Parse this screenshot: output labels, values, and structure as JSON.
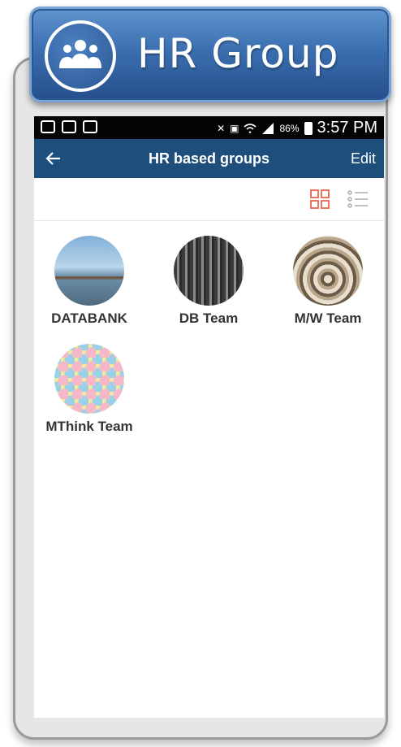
{
  "banner": {
    "title": "HR Group",
    "icon": "people-group-icon"
  },
  "status_bar": {
    "battery": "86%",
    "time": "3:57 PM"
  },
  "appbar": {
    "title": "HR based groups",
    "edit_label": "Edit",
    "back_icon": "back-arrow-icon"
  },
  "view_toggle": {
    "grid_icon": "grid-view-icon",
    "list_icon": "list-view-icon",
    "grid_color": "#e8654f"
  },
  "groups": [
    {
      "name": "DATABANK"
    },
    {
      "name": "DB Team"
    },
    {
      "name": "M/W Team"
    },
    {
      "name": "MThink Team"
    }
  ],
  "colors": {
    "appbar": "#1e4f7c",
    "banner": "#3b6fb0"
  }
}
